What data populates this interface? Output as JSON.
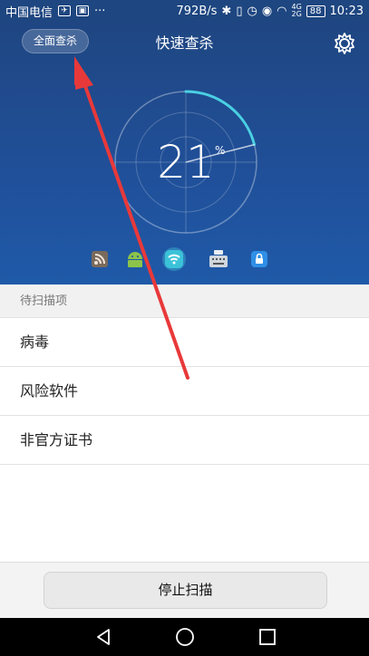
{
  "status_bar": {
    "carrier": "中国电信",
    "speed": "792B/s",
    "network": "4G",
    "network2": "2G",
    "battery": "88",
    "time": "10:23"
  },
  "header": {
    "full_scan_label": "全面查杀",
    "title": "快速查杀",
    "progress_value": "21",
    "progress_unit": "%"
  },
  "categories": {
    "icons": [
      "rss-icon",
      "android-icon",
      "wifi-icon",
      "keyboard-icon",
      "lock-icon"
    ],
    "active": "wifi-icon"
  },
  "scan_list": {
    "section_title": "待扫描项",
    "items": [
      "病毒",
      "风险软件",
      "非官方证书"
    ]
  },
  "footer": {
    "stop_label": "停止扫描"
  },
  "colors": {
    "header_bg": "#1f4f96",
    "accent": "#4ad0e2",
    "arrow": "#e8393a"
  }
}
